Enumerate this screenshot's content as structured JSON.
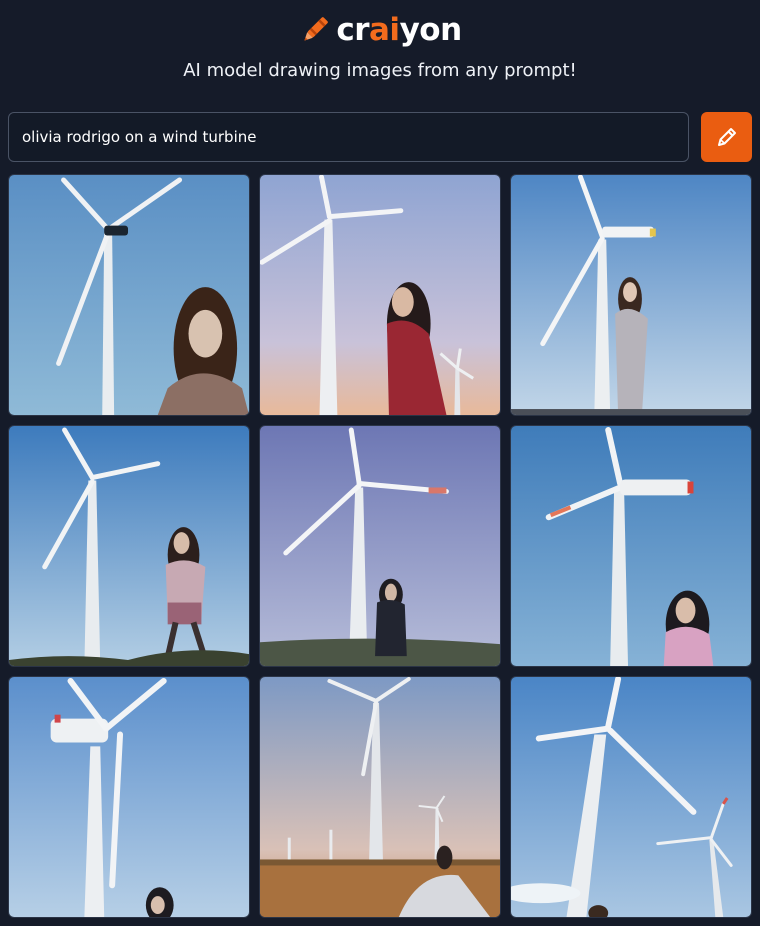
{
  "header": {
    "logo_prefix": "cr",
    "logo_accent": "ai",
    "logo_suffix": "yon",
    "logo_icon": "crayon-icon",
    "tagline": "AI model drawing images from any prompt!"
  },
  "search": {
    "value": "olivia rodrigo on a wind turbine",
    "button_icon": "pencil-icon"
  },
  "results": {
    "tiles": [
      {
        "label": "generated-image-1"
      },
      {
        "label": "generated-image-2"
      },
      {
        "label": "generated-image-3"
      },
      {
        "label": "generated-image-4"
      },
      {
        "label": "generated-image-5"
      },
      {
        "label": "generated-image-6"
      },
      {
        "label": "generated-image-7"
      },
      {
        "label": "generated-image-8"
      },
      {
        "label": "generated-image-9"
      }
    ]
  },
  "colors": {
    "background": "#151b29",
    "accent": "#f26b1d",
    "button": "#ea5d11",
    "input_border": "#4a5365"
  }
}
